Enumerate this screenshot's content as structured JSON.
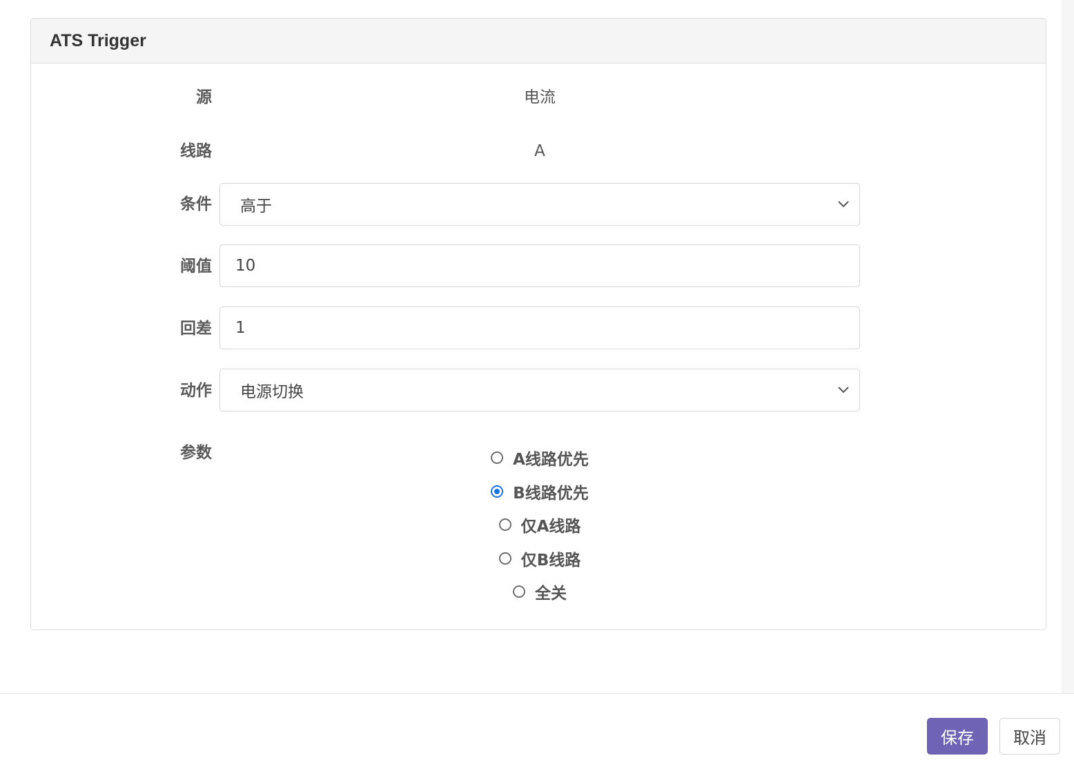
{
  "card": {
    "title": "ATS Trigger"
  },
  "form": {
    "source": {
      "label": "源",
      "value": "电流"
    },
    "line": {
      "label": "线路",
      "value": "A"
    },
    "condition": {
      "label": "条件",
      "selected": "高于"
    },
    "threshold": {
      "label": "阈值",
      "value": "10"
    },
    "hysteresis": {
      "label": "回差",
      "value": "1"
    },
    "action": {
      "label": "动作",
      "selected": "电源切换"
    },
    "params": {
      "label": "参数",
      "options": [
        {
          "label": "A线路优先",
          "checked": false
        },
        {
          "label": "B线路优先",
          "checked": true
        },
        {
          "label": "仅A线路",
          "checked": false
        },
        {
          "label": "仅B线路",
          "checked": false
        },
        {
          "label": "全关",
          "checked": false
        }
      ]
    }
  },
  "footer": {
    "save_label": "保存",
    "cancel_label": "取消"
  },
  "colors": {
    "primary_button": "#6f63b5",
    "radio_checked": "#1a73e8"
  },
  "icons": {
    "select_arrow": "chevron-down-icon"
  }
}
